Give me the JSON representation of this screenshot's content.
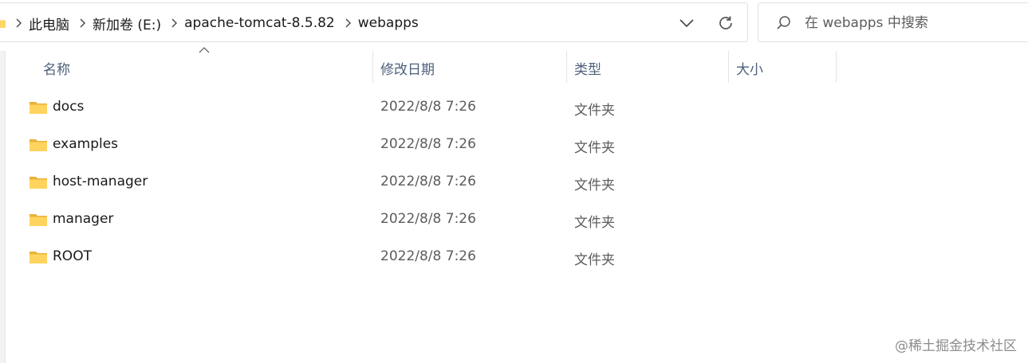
{
  "address": {
    "breadcrumbs": [
      "此电脑",
      "新加卷 (E:)",
      "apache-tomcat-8.5.82",
      "webapps"
    ]
  },
  "search": {
    "placeholder": "在 webapps 中搜索"
  },
  "columns": {
    "name": "名称",
    "date": "修改日期",
    "type": "类型",
    "size": "大小"
  },
  "files": [
    {
      "name": "docs",
      "date": "2022/8/8 7:26",
      "type": "文件夹",
      "size": ""
    },
    {
      "name": "examples",
      "date": "2022/8/8 7:26",
      "type": "文件夹",
      "size": ""
    },
    {
      "name": "host-manager",
      "date": "2022/8/8 7:26",
      "type": "文件夹",
      "size": ""
    },
    {
      "name": "manager",
      "date": "2022/8/8 7:26",
      "type": "文件夹",
      "size": ""
    },
    {
      "name": "ROOT",
      "date": "2022/8/8 7:26",
      "type": "文件夹",
      "size": ""
    }
  ],
  "watermark": "@稀土掘金技术社区",
  "icons": {
    "folder": "folder-icon",
    "chevron_right": "chevron-right-icon",
    "chevron_down": "chevron-down-icon",
    "refresh": "refresh-icon",
    "search": "search-icon",
    "sort_up": "sort-ascending-icon"
  },
  "colors": {
    "folder": "#f4c542",
    "header_text": "#4c607a",
    "meta_text": "#5c5c5c",
    "border": "#e1e1e1"
  }
}
